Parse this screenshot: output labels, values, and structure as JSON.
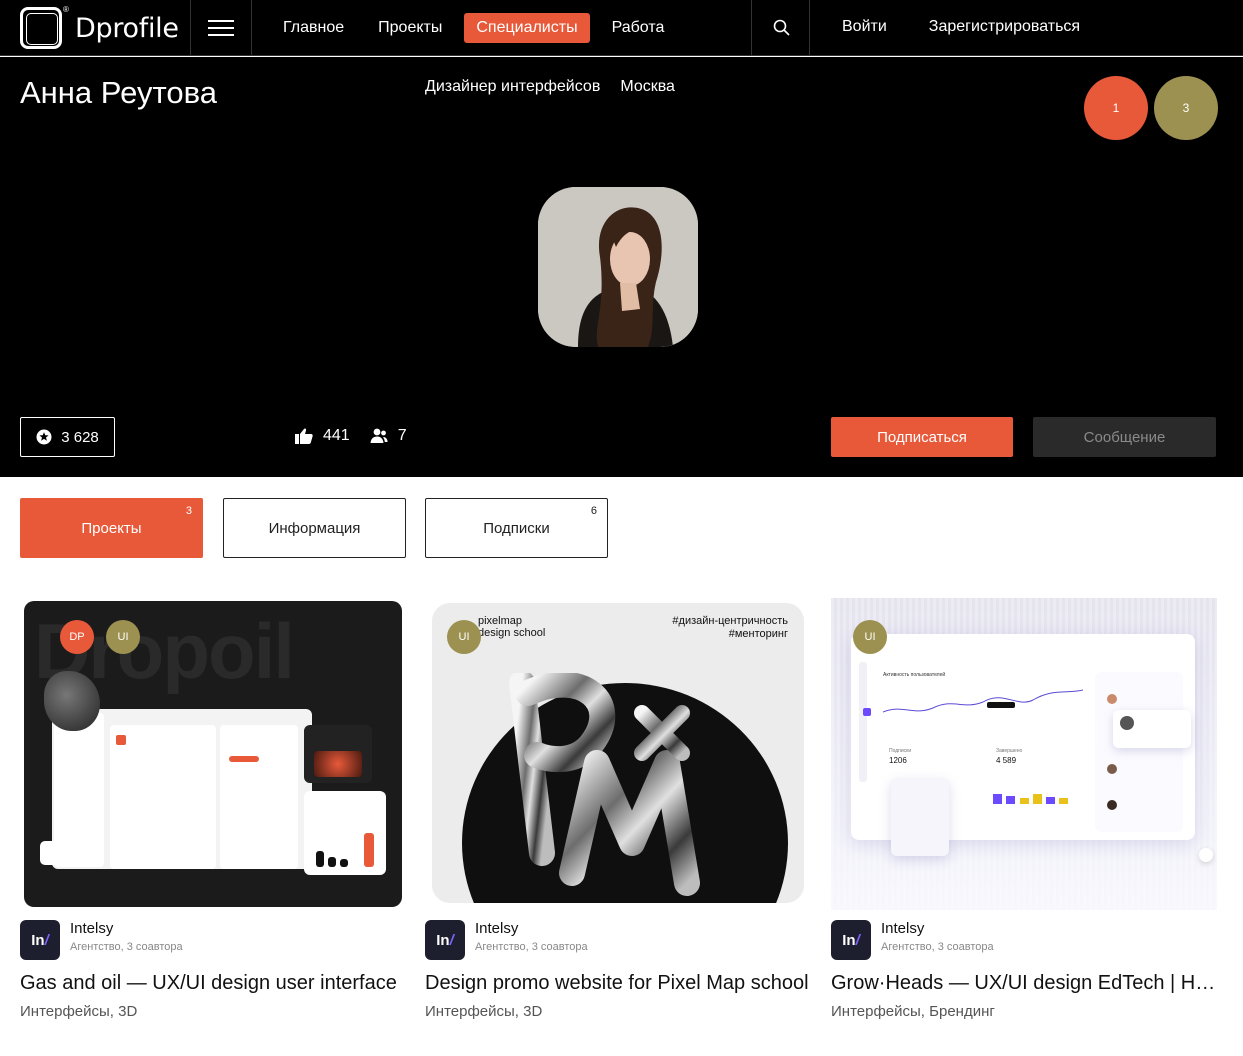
{
  "nav": {
    "logo_text": "Dprofile",
    "logo_reg": "®",
    "links": [
      "Главное",
      "Проекты",
      "Специалисты",
      "Работа"
    ],
    "active_link": "Специалисты",
    "login": "Войти",
    "register": "Зарегистрироваться"
  },
  "profile": {
    "name": "Анна Реутова",
    "role": "Дизайнер интерфейсов",
    "city": "Москва",
    "badges": [
      "1",
      "3"
    ],
    "rating": "3 628",
    "likes": "441",
    "followers": "7",
    "subscribe_label": "Подписаться",
    "message_label": "Сообщение"
  },
  "tabs": [
    {
      "label": "Проекты",
      "count": "3"
    },
    {
      "label": "Информация",
      "count": ""
    },
    {
      "label": "Подписки",
      "count": "6"
    }
  ],
  "cards": [
    {
      "author": "Intelsy",
      "author_sub": "Агентство, 3 соавтора",
      "title": "Gas and oil — UX/UI design user interface",
      "tags": "Интерфейсы, 3D",
      "badges": [
        "DP",
        "UI"
      ],
      "thumb_bg_word": "Dropoil"
    },
    {
      "author": "Intelsy",
      "author_sub": "Агентство, 3 соавтора",
      "title": "Design promo website for Pixel Map school",
      "tags": "Интерфейсы, 3D",
      "badges": [
        "UI"
      ],
      "thumb_brand_line1": "pixelmap",
      "thumb_brand_line2": "design school",
      "thumb_hashtag1": "#дизайн-центричность",
      "thumb_hashtag2": "#менторинг"
    },
    {
      "author": "Intelsy",
      "author_sub": "Агентство, 3 соавтора",
      "title": "Grow·Heads — UX/UI design EdTech | Hire",
      "tags": "Интерфейсы, Брендинг",
      "badges": [
        "UI"
      ],
      "thumb_chart_title": "Активность пользователей",
      "thumb_stat1_label": "Подписки",
      "thumb_stat1_value": "1206",
      "thumb_stat2_label": "Завершено",
      "thumb_stat2_value": "4 589"
    }
  ],
  "colors": {
    "accent": "#e8593a",
    "olive": "#9c9150",
    "hero_bg": "#000000"
  }
}
